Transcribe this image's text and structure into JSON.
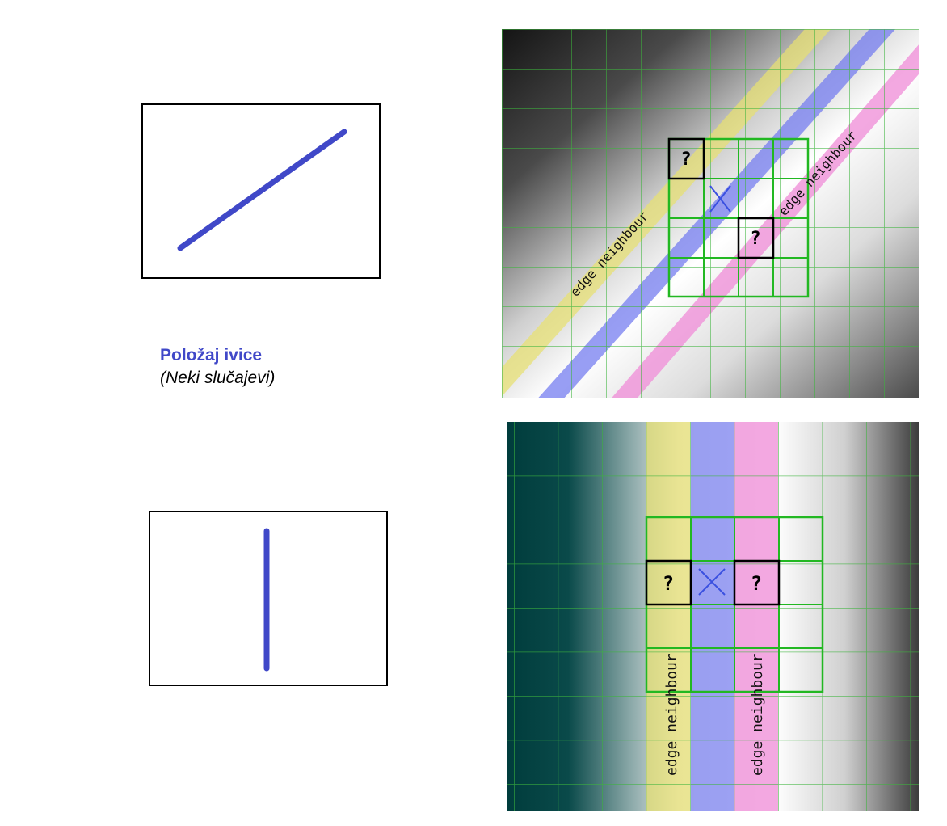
{
  "caption": {
    "title": "Položaj ivice",
    "subtitle": "(Neki slučajevi)"
  },
  "colors": {
    "edge": "#4048c8",
    "grid": "#3cb43c",
    "neighbour_yellow": "#e8e070",
    "neighbour_blue": "#7078f0",
    "neighbour_pink": "#f090d8"
  },
  "diagonal_panel": {
    "left_band_label": "edge neighbour",
    "right_band_label": "edge neighbour",
    "unknown_mark": "?"
  },
  "vertical_panel": {
    "left_band_label": "edge neighbour",
    "right_band_label": "edge neighbour",
    "unknown_mark": "?"
  }
}
